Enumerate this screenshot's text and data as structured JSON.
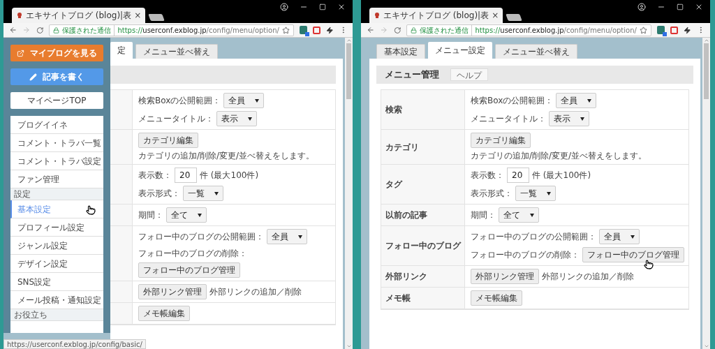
{
  "windows": [
    {
      "tab_title": "エキサイトブログ (blog)|表",
      "tab_close": "×",
      "secure_label": "保護された通信",
      "url": {
        "scheme": "https://",
        "host": "userconf.exblog.jp",
        "path": "/config/menu/option/"
      },
      "sidebar": {
        "buttons": [
          {
            "kind": "view",
            "label": "マイブログを見る"
          },
          {
            "kind": "write",
            "label": "記事を書く"
          },
          {
            "kind": "top",
            "label": "マイページTOP"
          }
        ],
        "items": [
          {
            "kind": "item",
            "label": "ブログイイネ",
            "selected": false
          },
          {
            "kind": "item",
            "label": "コメント・トラバ一覧",
            "selected": false
          },
          {
            "kind": "item",
            "label": "コメント・トラバ設定",
            "selected": false
          },
          {
            "kind": "item",
            "label": "ファン管理",
            "selected": false
          },
          {
            "kind": "section",
            "label": "設定"
          },
          {
            "kind": "item",
            "label": "基本設定",
            "selected": true
          },
          {
            "kind": "item",
            "label": "プロフィール設定",
            "selected": false
          },
          {
            "kind": "item",
            "label": "ジャンル設定",
            "selected": false
          },
          {
            "kind": "item",
            "label": "デザイン設定",
            "selected": false
          },
          {
            "kind": "item",
            "label": "SNS設定",
            "selected": false
          },
          {
            "kind": "item",
            "label": "メール投稿・通知設定",
            "selected": false
          },
          {
            "kind": "section",
            "label": "お役立ち"
          }
        ]
      },
      "page": {
        "tabs": [
          {
            "label": "定",
            "selected": true
          },
          {
            "label": "メニュー並べ替え",
            "selected": false
          }
        ],
        "rows": [
          {
            "lines": [
              [
                {
                  "kind": "label",
                  "text": "検索Boxの公開範囲："
                },
                {
                  "kind": "select",
                  "value": "全員"
                }
              ],
              [
                {
                  "kind": "label",
                  "text": "メニュータイトル："
                },
                {
                  "kind": "select",
                  "value": "表示"
                }
              ]
            ]
          },
          {
            "lines": [
              [
                {
                  "kind": "button",
                  "text": "カテゴリ編集"
                },
                {
                  "kind": "text",
                  "text": "カテゴリの追加/削除/変更/並べ替えをします。"
                }
              ]
            ]
          },
          {
            "lines": [
              [
                {
                  "kind": "label",
                  "text": "表示数："
                },
                {
                  "kind": "input",
                  "value": "20"
                },
                {
                  "kind": "text",
                  "text": "件 (最大100件)"
                }
              ],
              [
                {
                  "kind": "label",
                  "text": "表示形式："
                },
                {
                  "kind": "select",
                  "value": "一覧"
                }
              ]
            ]
          },
          {
            "lines": [
              [
                {
                  "kind": "label",
                  "text": "期間："
                },
                {
                  "kind": "select",
                  "value": "全て"
                }
              ]
            ]
          },
          {
            "lines": [
              [
                {
                  "kind": "label",
                  "text": "フォロー中のブログの公開範囲："
                },
                {
                  "kind": "select",
                  "value": "全員"
                }
              ],
              [
                {
                  "kind": "label",
                  "text": "フォロー中のブログの削除："
                },
                {
                  "kind": "button",
                  "text": "フォロー中のブログ管理"
                }
              ]
            ]
          },
          {
            "lines": [
              [
                {
                  "kind": "button",
                  "text": "外部リンク管理"
                },
                {
                  "kind": "text",
                  "text": "外部リンクの追加／削除"
                }
              ]
            ]
          },
          {
            "lines": [
              [
                {
                  "kind": "button",
                  "text": "メモ帳編集"
                }
              ]
            ]
          }
        ]
      },
      "status_url": "https://userconf.exblog.jp/config/basic/"
    },
    {
      "tab_title": "エキサイトブログ (blog)|表",
      "tab_close": "×",
      "secure_label": "保護された通信",
      "url": {
        "scheme": "https://",
        "host": "userconf.exblog.jp",
        "path": "/config/menu/option/"
      },
      "page": {
        "tabs": [
          {
            "label": "基本設定",
            "selected": false
          },
          {
            "label": "メニュー設定",
            "selected": true
          },
          {
            "label": "メニュー並べ替え",
            "selected": false
          }
        ],
        "header": {
          "title": "メニュー管理",
          "help": "ヘルプ"
        },
        "rows": [
          {
            "label": "検索",
            "lines": [
              [
                {
                  "kind": "label",
                  "text": "検索Boxの公開範囲："
                },
                {
                  "kind": "select",
                  "value": "全員"
                }
              ],
              [
                {
                  "kind": "label",
                  "text": "メニュータイトル："
                },
                {
                  "kind": "select",
                  "value": "表示"
                }
              ]
            ]
          },
          {
            "label": "カテゴリ",
            "lines": [
              [
                {
                  "kind": "button",
                  "text": "カテゴリ編集"
                },
                {
                  "kind": "text",
                  "text": "カテゴリの追加/削除/変更/並べ替えをします。"
                }
              ]
            ]
          },
          {
            "label": "タグ",
            "lines": [
              [
                {
                  "kind": "label",
                  "text": "表示数："
                },
                {
                  "kind": "input",
                  "value": "20"
                },
                {
                  "kind": "text",
                  "text": "件 (最大100件)"
                }
              ],
              [
                {
                  "kind": "label",
                  "text": "表示形式："
                },
                {
                  "kind": "select",
                  "value": "一覧"
                }
              ]
            ]
          },
          {
            "label": "以前の記事",
            "lines": [
              [
                {
                  "kind": "label",
                  "text": "期間："
                },
                {
                  "kind": "select",
                  "value": "全て"
                }
              ]
            ]
          },
          {
            "label": "フォロー中のブログ",
            "lines": [
              [
                {
                  "kind": "label",
                  "text": "フォロー中のブログの公開範囲："
                },
                {
                  "kind": "select",
                  "value": "全員"
                }
              ],
              [
                {
                  "kind": "label",
                  "text": "フォロー中のブログの削除："
                },
                {
                  "kind": "button",
                  "text": "フォロー中のブログ管理"
                }
              ]
            ]
          },
          {
            "label": "外部リンク",
            "lines": [
              [
                {
                  "kind": "button",
                  "text": "外部リンク管理"
                },
                {
                  "kind": "text",
                  "text": "外部リンクの追加／削除"
                }
              ]
            ]
          },
          {
            "label": "メモ帳",
            "lines": [
              [
                {
                  "kind": "button",
                  "text": "メモ帳編集"
                }
              ]
            ]
          }
        ]
      }
    }
  ]
}
